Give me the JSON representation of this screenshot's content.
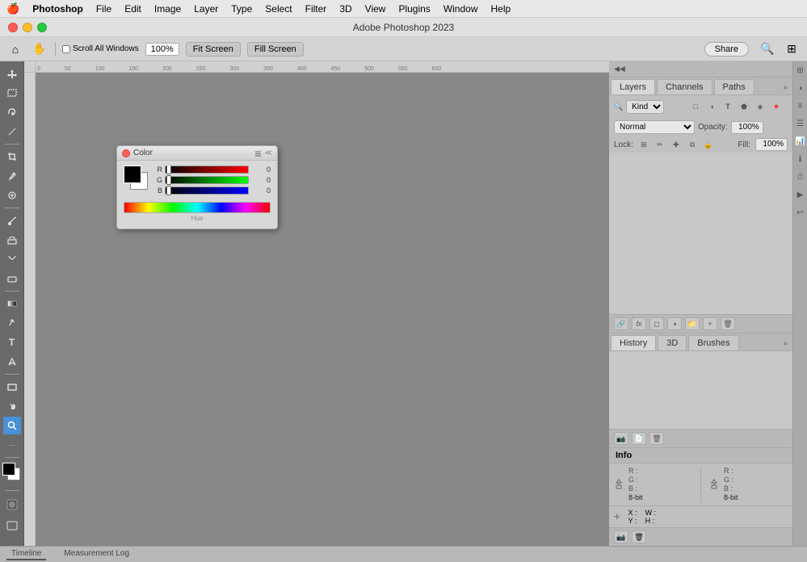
{
  "app": {
    "name": "Photoshop",
    "title": "Adobe Photoshop 2023"
  },
  "menubar": {
    "apple": "🍎",
    "app_name": "Photoshop",
    "menus": [
      "File",
      "Edit",
      "Image",
      "Layer",
      "Type",
      "Select",
      "Filter",
      "3D",
      "View",
      "Plugins",
      "Window",
      "Help"
    ]
  },
  "toolbar": {
    "zoom_value": "100%",
    "scroll_all_label": "Scroll All Windows",
    "fit_screen_label": "Fit Screen",
    "fill_screen_label": "Fill Screen",
    "share_label": "Share"
  },
  "color_dialog": {
    "title": "Color",
    "r_label": "R",
    "g_label": "G",
    "b_label": "B",
    "r_value": "0",
    "g_value": "0",
    "b_value": "0",
    "footer": "Hue"
  },
  "layers_panel": {
    "tabs": [
      "Layers",
      "Channels",
      "Paths"
    ],
    "active_tab": "Layers",
    "search_placeholder": "Kind",
    "mode_label": "Normal",
    "opacity_label": "Opacity:",
    "opacity_value": "100%",
    "lock_label": "Lock:",
    "fill_label": "Fill:",
    "fill_value": "100%"
  },
  "history_panel": {
    "tabs": [
      "History",
      "3D",
      "Brushes"
    ],
    "active_tab": "History"
  },
  "info_panel": {
    "title": "Info",
    "r_label": "R :",
    "g_label": "G :",
    "b_label": "B :",
    "bit_label": "8-bit",
    "x_label": "X :",
    "y_label": "Y :",
    "w_label": "W :",
    "h_label": "H :"
  },
  "status_bar": {
    "tabs": [
      "Timeline",
      "Measurement Log"
    ]
  }
}
